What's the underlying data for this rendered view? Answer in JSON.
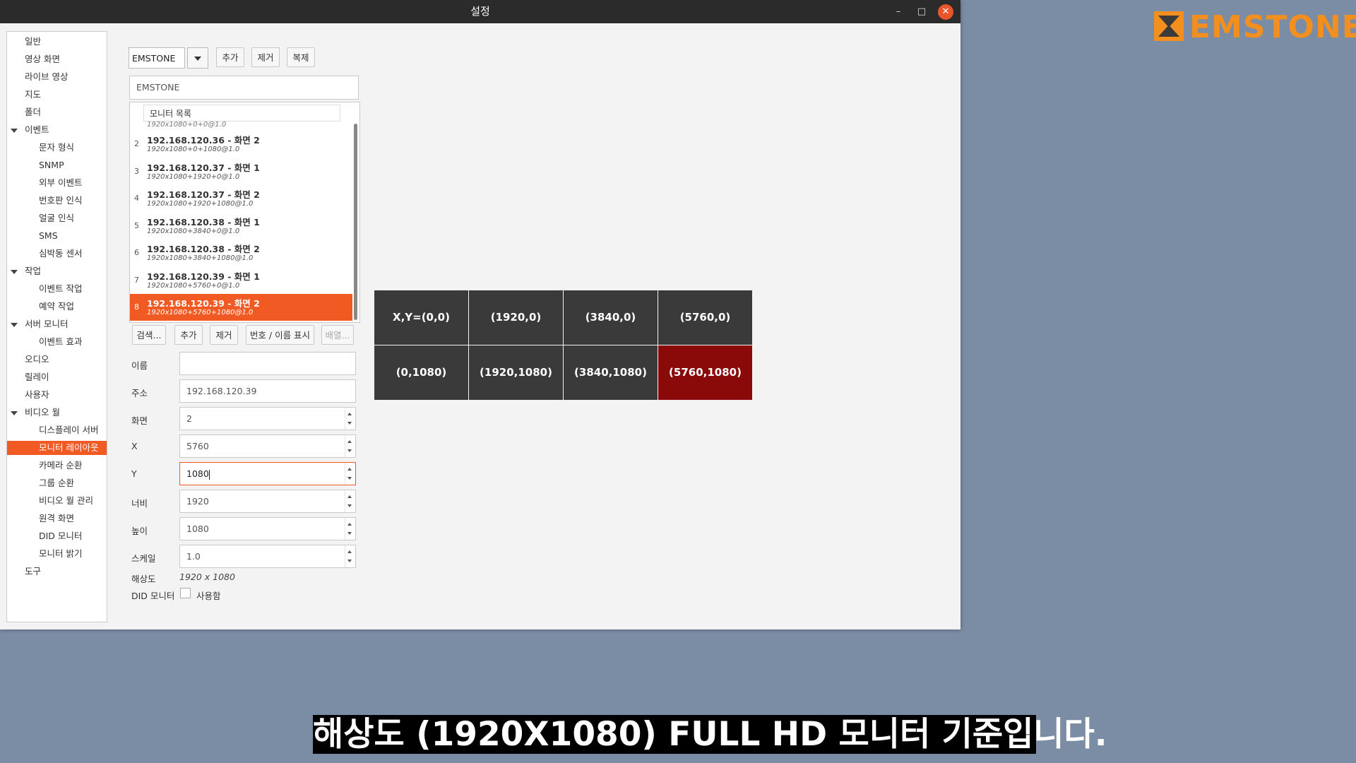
{
  "window": {
    "title": "설정"
  },
  "sidebar": {
    "items": [
      {
        "label": "일반",
        "level": 0
      },
      {
        "label": "영상 화면",
        "level": 0
      },
      {
        "label": "라이브 영상",
        "level": 0
      },
      {
        "label": "지도",
        "level": 0
      },
      {
        "label": "폴더",
        "level": 0
      },
      {
        "label": "이벤트",
        "level": 0,
        "expanded": true
      },
      {
        "label": "문자 형식",
        "level": 1
      },
      {
        "label": "SNMP",
        "level": 1
      },
      {
        "label": "외부 이벤트",
        "level": 1
      },
      {
        "label": "번호판 인식",
        "level": 1
      },
      {
        "label": "얼굴 인식",
        "level": 1
      },
      {
        "label": "SMS",
        "level": 1
      },
      {
        "label": "심박동 센서",
        "level": 1
      },
      {
        "label": "작업",
        "level": 0,
        "expanded": true
      },
      {
        "label": "이벤트 작업",
        "level": 1
      },
      {
        "label": "예약 작업",
        "level": 1
      },
      {
        "label": "서버 모니터",
        "level": 0,
        "expanded": true
      },
      {
        "label": "이벤트 효과",
        "level": 1
      },
      {
        "label": "오디오",
        "level": 0
      },
      {
        "label": "릴레이",
        "level": 0
      },
      {
        "label": "사용자",
        "level": 0
      },
      {
        "label": "비디오 월",
        "level": 0,
        "expanded": true
      },
      {
        "label": "디스플레이 서버",
        "level": 1
      },
      {
        "label": "모니터 레이아웃",
        "level": 1,
        "selected": true
      },
      {
        "label": "카메라 순환",
        "level": 1
      },
      {
        "label": "그룹 순환",
        "level": 1
      },
      {
        "label": "비디오 월 관리",
        "level": 1
      },
      {
        "label": "원격 화면",
        "level": 1
      },
      {
        "label": "DID 모니터",
        "level": 1
      },
      {
        "label": "모니터 밝기",
        "level": 1
      },
      {
        "label": "도구",
        "level": 0
      }
    ]
  },
  "toolbar": {
    "combo_value": "EMSTONE",
    "add_label": "추가",
    "remove_label": "제거",
    "copy_label": "복제"
  },
  "layout_name": "EMSTONE",
  "monitor_list": {
    "header": "모니터 목록",
    "partial_first_sub": "1920x1080+0+0@1.0",
    "rows": [
      {
        "num": "2",
        "title": "192.168.120.36 - 화면 2",
        "sub": "1920x1080+0+1080@1.0"
      },
      {
        "num": "3",
        "title": "192.168.120.37 - 화면 1",
        "sub": "1920x1080+1920+0@1.0"
      },
      {
        "num": "4",
        "title": "192.168.120.37 - 화면 2",
        "sub": "1920x1080+1920+1080@1.0"
      },
      {
        "num": "5",
        "title": "192.168.120.38 - 화면 1",
        "sub": "1920x1080+3840+0@1.0"
      },
      {
        "num": "6",
        "title": "192.168.120.38 - 화면 2",
        "sub": "1920x1080+3840+1080@1.0"
      },
      {
        "num": "7",
        "title": "192.168.120.39 - 화면 1",
        "sub": "1920x1080+5760+0@1.0"
      },
      {
        "num": "8",
        "title": "192.168.120.39 - 화면 2",
        "sub": "1920x1080+5760+1080@1.0",
        "selected": true
      }
    ]
  },
  "list_buttons": {
    "search": "검색...",
    "add": "추가",
    "remove": "제거",
    "show_label": "번호 / 이름 표시",
    "arrange": "배열..."
  },
  "form": {
    "name_label": "이름",
    "name_value": "",
    "address_label": "주소",
    "address_value": "192.168.120.39",
    "screen_label": "화면",
    "screen_value": "2",
    "x_label": "X",
    "x_value": "5760",
    "y_label": "Y",
    "y_value": "1080",
    "width_label": "너비",
    "width_value": "1920",
    "height_label": "높이",
    "height_value": "1080",
    "scale_label": "스케일",
    "scale_value": "1.0",
    "resolution_label": "해상도",
    "resolution_value": "1920 x 1080",
    "did_label": "DID 모니터",
    "did_checkbox_label": "사용함",
    "did_checked": false
  },
  "layout_preview": {
    "cells": [
      {
        "label": "X,Y=(0,0)"
      },
      {
        "label": "(1920,0)"
      },
      {
        "label": "(3840,0)"
      },
      {
        "label": "(5760,0)"
      },
      {
        "label": "(0,1080)"
      },
      {
        "label": "(1920,1080)"
      },
      {
        "label": "(3840,1080)"
      },
      {
        "label": "(5760,1080)",
        "selected": true
      }
    ]
  },
  "logo": {
    "text": "EMSTONE",
    "color": "#f28f1e"
  },
  "subtitle": "해상도 (1920X1080) FULL HD 모니터 기준입니다."
}
